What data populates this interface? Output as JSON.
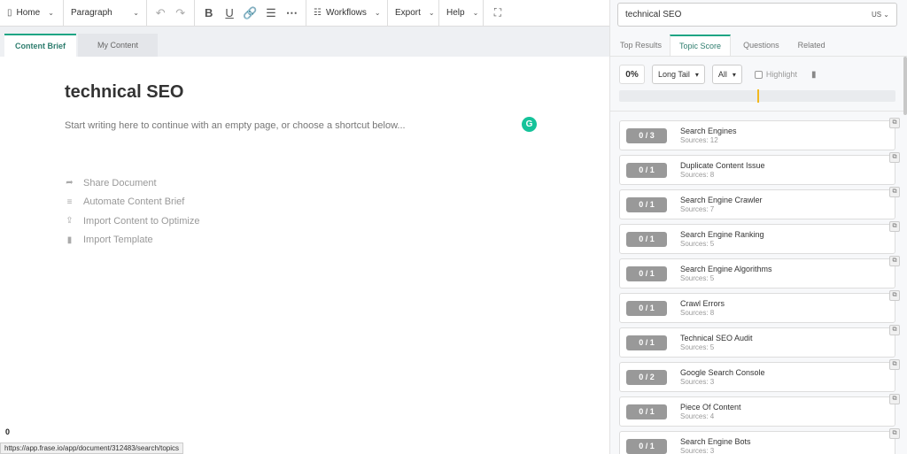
{
  "toolbar": {
    "home_label": "Home",
    "paragraph_label": "Paragraph",
    "workflows_label": "Workflows",
    "export_label": "Export",
    "help_label": "Help"
  },
  "editor_tabs": [
    "Content Brief",
    "My Content"
  ],
  "editor": {
    "title": "technical SEO",
    "hint": "Start writing here to continue with an empty page, or choose a shortcut below...",
    "grammarly_glyph": "G",
    "shortcuts": [
      {
        "label": "Share Document",
        "icon": "share-icon"
      },
      {
        "label": "Automate Content Brief",
        "icon": "list-icon"
      },
      {
        "label": "Import Content to Optimize",
        "icon": "upload-icon"
      },
      {
        "label": "Import Template",
        "icon": "document-icon"
      }
    ],
    "counter": "0",
    "status_url": "https://app.frase.io/app/document/312483/search/topics"
  },
  "panel": {
    "query": "technical SEO",
    "country": "US",
    "tabs": [
      "Top Results",
      "Topic Score",
      "Questions",
      "Related"
    ],
    "active_tab": "Topic Score",
    "score": "0%",
    "filter": "Long Tail",
    "scope": "All",
    "highlight_label": "Highlight",
    "score_marker": 0.5,
    "topics": [
      {
        "count": "0 / 3",
        "name": "Search Engines",
        "sources": "Sources: 12"
      },
      {
        "count": "0 / 1",
        "name": "Duplicate Content Issue",
        "sources": "Sources: 8"
      },
      {
        "count": "0 / 1",
        "name": "Search Engine Crawler",
        "sources": "Sources: 7"
      },
      {
        "count": "0 / 1",
        "name": "Search Engine Ranking",
        "sources": "Sources: 5"
      },
      {
        "count": "0 / 1",
        "name": "Search Engine Algorithms",
        "sources": "Sources: 5"
      },
      {
        "count": "0 / 1",
        "name": "Crawl Errors",
        "sources": "Sources: 8"
      },
      {
        "count": "0 / 1",
        "name": "Technical SEO Audit",
        "sources": "Sources: 5"
      },
      {
        "count": "0 / 2",
        "name": "Google Search Console",
        "sources": "Sources: 3"
      },
      {
        "count": "0 / 1",
        "name": "Piece Of Content",
        "sources": "Sources: 4"
      },
      {
        "count": "0 / 1",
        "name": "Search Engine Bots",
        "sources": "Sources: 3"
      }
    ]
  },
  "colors": {
    "accent": "#1ea584",
    "pill": "#999999",
    "marker": "#f2b81e"
  }
}
